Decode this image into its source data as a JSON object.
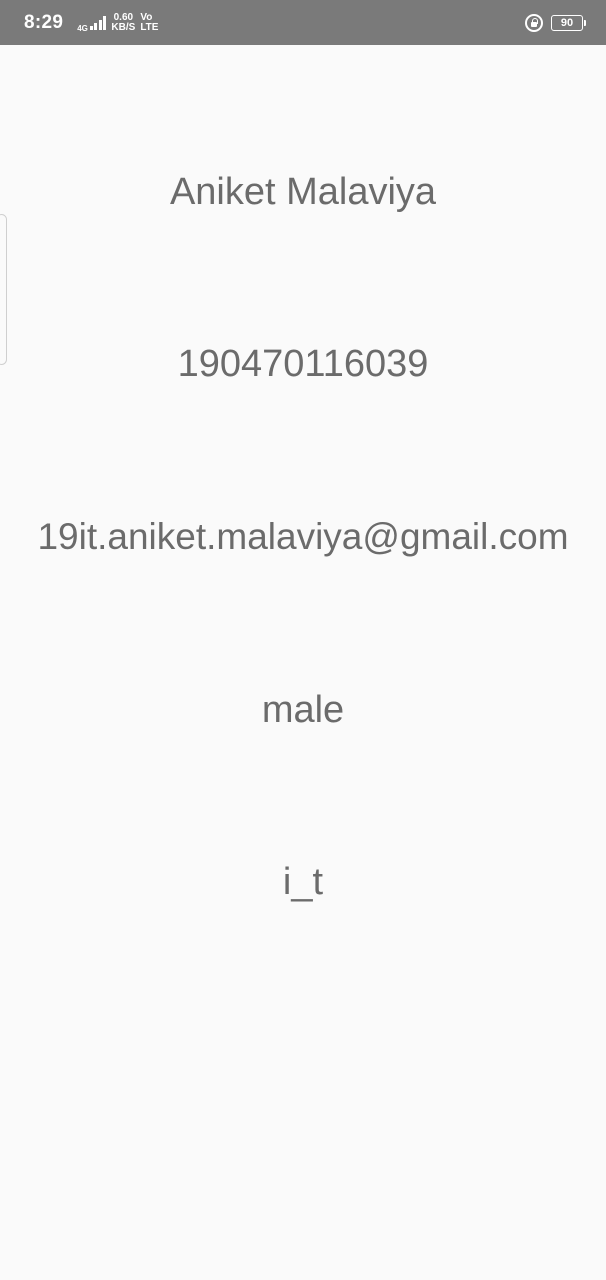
{
  "status_bar": {
    "time": "8:29",
    "network_type": "4G",
    "speed_value": "0.60",
    "speed_unit": "KB/S",
    "volte_top": "Vo",
    "volte_bottom": "LTE",
    "battery_level": "90",
    "icons": [
      "signal-icon",
      "rotation-lock-icon",
      "battery-icon"
    ]
  },
  "profile": {
    "name": "Aniket Malaviya",
    "enrollment": "190470116039",
    "email": "19it.aniket.malaviya@gmail.com",
    "gender": "male",
    "branch": "i_t"
  },
  "colors": {
    "status_bar_bg": "#7a7a7a",
    "background": "#fafafa",
    "text": "#6b6b6b"
  }
}
